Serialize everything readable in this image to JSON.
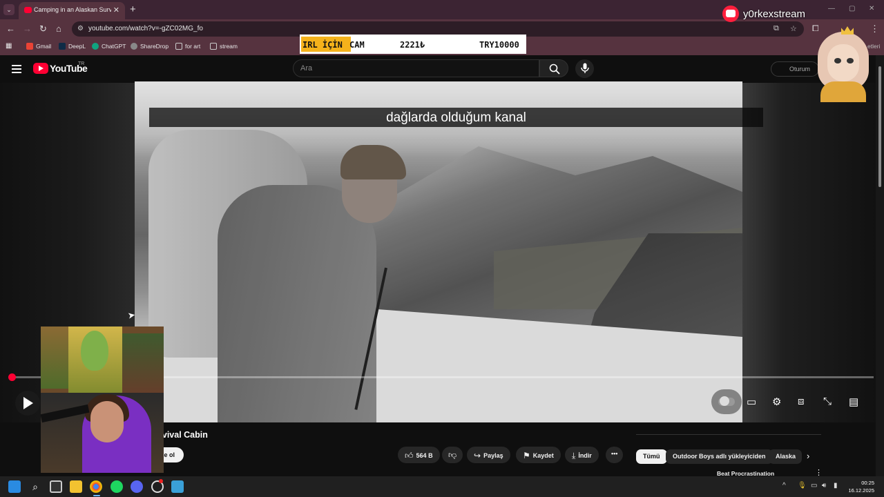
{
  "browser": {
    "tab": {
      "title": "Camping in an Alaskan Survival",
      "favicon_color": "#ff0033"
    },
    "url": "youtube.com/watch?v=-gZC02MG_fo",
    "bookmarks": [
      {
        "label": "Gmail",
        "icon": "gmail-icon",
        "color": "#ea4335"
      },
      {
        "label": "DeepL",
        "icon": "deepl-icon",
        "color": "#0f2b46"
      },
      {
        "label": "ChatGPT",
        "icon": "chatgpt-icon",
        "color": "#10a37f"
      },
      {
        "label": "ShareDrop",
        "icon": "sharedrop-icon",
        "color": "#888888"
      },
      {
        "label": "for art",
        "icon": "folder-icon",
        "color": "#cccccc"
      },
      {
        "label": "stream",
        "icon": "folder-icon",
        "color": "#cccccc"
      }
    ],
    "bookmarks_overflow": "etleri"
  },
  "overlay": {
    "irl_label": "IRL İÇİN",
    "irl_item": "CAM",
    "irl_current": "2221₺",
    "irl_goal": "TRY10000",
    "channel_name": "y0rkexstream"
  },
  "youtube": {
    "logo_text": "YouTube",
    "country": "TR",
    "search_placeholder": "Ara",
    "sign_in": "Oturum"
  },
  "player": {
    "caption": "dağlarda olduğum kanal",
    "progress": 0.003
  },
  "video": {
    "title_visible": "rvival Cabin",
    "subscribe_visible": "ne ol",
    "likes": "564 B",
    "share": "Paylaş",
    "save": "Kaydet",
    "download": "İndir"
  },
  "recommendations": {
    "chips": [
      "Tümü",
      "Outdoor Boys adlı yükleyiciden",
      "Alaska"
    ],
    "first_title": "Beat Procrastination"
  },
  "taskbar": {
    "time": "00:25",
    "date": "16.12.2025"
  },
  "colors": {
    "accent_red": "#ff0033",
    "browser_frame": "#56333f",
    "youtube_bg": "#0f0f0f"
  }
}
